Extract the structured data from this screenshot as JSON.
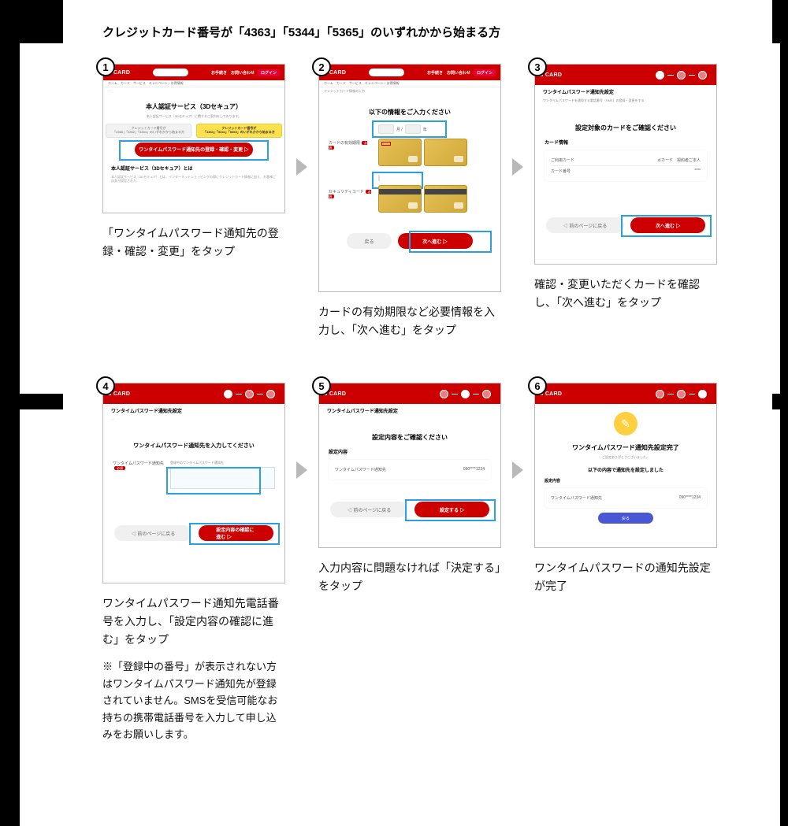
{
  "heading": "クレジットカード番号が「4363」「5344」「5365」のいずれかから始まる方",
  "logo": "d CARD",
  "shot1": {
    "menu": "ホーム　カード　サービス　キャンペーン・お得情報",
    "title": "本人認証サービス（3Dセキュア）",
    "pillGrayTop": "クレジットカード番号が",
    "pillGray": "「4980」「5302」「5334」のいずれかから始まる方",
    "pillYelTop": "クレジットカード番号が",
    "pillYel": "「4363」「5344」「5365」のいずれかから始まる方",
    "redbtn": "ワンタイムパスワード通知先の登録・確認・変更 ▷",
    "sectitle": "本人認証サービス（3Dセキュア）とは"
  },
  "shot2": {
    "breadcrumb": "クレジットカード情報の入力",
    "title": "以下の情報をご入力ください",
    "row1": "カードの有効期限",
    "row2": "セキュリティコード",
    "back": "戻る",
    "next": "次へ進む ▷"
  },
  "shot3": {
    "breadcrumb": "ワンタイムパスワード通知先設定",
    "title": "設定対象のカードをご確認ください",
    "cardinfo": "カード情報",
    "r1a": "ご利用カード",
    "r1b": "ｄカード　契約者ご本人",
    "r2a": "カード番号",
    "back": "◁ 前のページに戻る",
    "next": "次へ進む ▷"
  },
  "shot4": {
    "breadcrumb": "ワンタイムパスワード通知先設定",
    "title": "ワンタイムパスワード通知先を入力してください",
    "lab": "ワンタイムパスワード通知先",
    "sublab": "登録中のワンタイムパスワード通知先",
    "back": "◁ 前のページに戻る",
    "next": "設定内容の確認に進む ▷"
  },
  "shot5": {
    "breadcrumb": "ワンタイムパスワード通知先設定",
    "title": "設定内容をご確認ください",
    "sect": "設定内容",
    "r1": "ワンタイムパスワード通知先",
    "back": "◁ 前のページに戻る",
    "next": "設定する ▷"
  },
  "shot6": {
    "title": "ワンタイムパスワード通知先設定完了",
    "thanks": "ご設定ありがとうございました。",
    "sub": "以下の内容で通知先を設定しました",
    "sect": "設定内容",
    "r1": "ワンタイムパスワード通知先",
    "btn": "戻る"
  },
  "cap1": "「ワンタイムパスワード通知先の登録・確認・変更」をタップ",
  "cap2": "カードの有効期限など必要情報を入力し、「次へ進む」をタップ",
  "cap3": "確認・変更いただくカードを確認し、「次へ進む」をタップ",
  "cap4": "ワンタイムパスワード通知先電話番号を入力し、「設定内容の確認に進む」をタップ",
  "cap4note": "※「登録中の番号」が表示されない方はワンタイムパスワード通知先が登録されていません。SMSを受信可能なお持ちの携帯電話番号を入力して申し込みをお願いします。",
  "cap5": "入力内容に問題なければ「決定する」をタップ",
  "cap6": "ワンタイムパスワードの通知先設定が完了"
}
